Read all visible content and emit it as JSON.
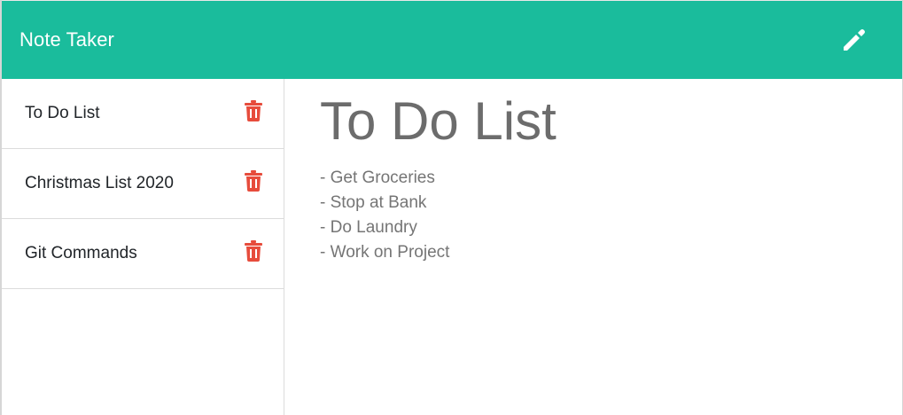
{
  "navbar": {
    "brand": "Note Taker",
    "new_note_icon": "pencil-icon"
  },
  "sidebar": {
    "notes": [
      {
        "title": "To Do List",
        "delete_icon": "trash-icon"
      },
      {
        "title": "Christmas List 2020",
        "delete_icon": "trash-icon"
      },
      {
        "title": "Git Commands",
        "delete_icon": "trash-icon"
      }
    ]
  },
  "editor": {
    "title": "To Do List",
    "lines": [
      "- Get Groceries",
      "- Stop at Bank",
      "- Do Laundry",
      "- Work on Project"
    ]
  },
  "colors": {
    "navbar": "#1abc9c",
    "delete": "#e74c3c",
    "heading": "#6c6c6c",
    "body_text": "#757575"
  }
}
